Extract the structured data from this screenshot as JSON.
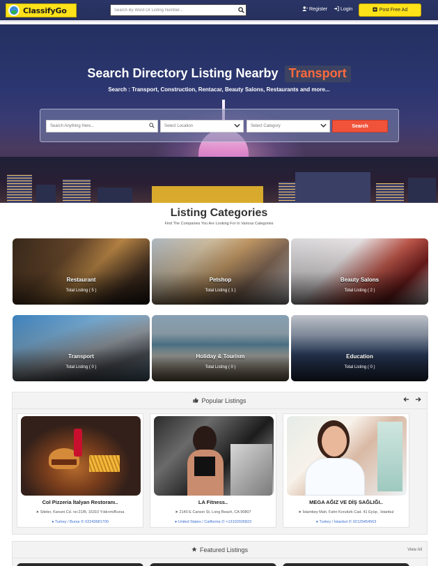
{
  "brand": {
    "name": "ClassifyGo"
  },
  "header": {
    "search_placeholder": "Search By Word Or Listing Number...",
    "register": "Register",
    "login": "Login",
    "post_ad": "Post Free Ad"
  },
  "hero": {
    "title": "Search Directory Listing Nearby",
    "highlight": "Transport",
    "subtitle": "Search : Transport, Construction, Rentacar, Beauty Salons, Restaurants and more...",
    "search_placeholder": "Search Anything Here...",
    "location_label": "Select Location",
    "category_label": "Select Category",
    "search_button": "Search"
  },
  "categories": {
    "title": "Listing Categories",
    "subtitle": "Find The Companies You Are Looking For In Various Categories",
    "items": [
      {
        "name": "Restaurant",
        "count": "Total Listing ( 5 )"
      },
      {
        "name": "Petshop",
        "count": "Total Listing ( 1 )"
      },
      {
        "name": "Beauty Salons",
        "count": "Total Listing ( 2 )"
      },
      {
        "name": "Transport",
        "count": "Total Listing ( 0 )"
      },
      {
        "name": "Holiday & Tourism",
        "count": "Total Listing ( 0 )"
      },
      {
        "name": "Education",
        "count": "Total Listing ( 0 )"
      }
    ]
  },
  "popular": {
    "title": "Popular Listings",
    "items": [
      {
        "title": "Col Pizzeria İtalyan Restoranı..",
        "address": "Siteler, Kanuni Cd. no:21/B, 16310 Yıldırım/Bursa",
        "location": "Turkey / Bursa",
        "phone": "02243681700"
      },
      {
        "title": "LA Fitness..",
        "address": "2140 E Carson St, Long Beach, CA 90807",
        "location": "United States / California",
        "phone": "+13102026823"
      },
      {
        "title": "MEGA AĞIZ VE DİŞ SAĞLIĞI..",
        "address": "İslambey Mah. Fahri Korutürk Cad. 41 Eyüp , İstanbul",
        "location": "Turkey / İstanbul",
        "phone": "02125454563"
      }
    ]
  },
  "featured": {
    "title": "Featured Listings",
    "view_all": "View All"
  },
  "colors": {
    "navbar": "#2a3566",
    "brand_yellow": "#fde21a",
    "accent_orange": "#ff6a3d",
    "search_red": "#f0533a",
    "link_blue": "#3b6fd1"
  }
}
